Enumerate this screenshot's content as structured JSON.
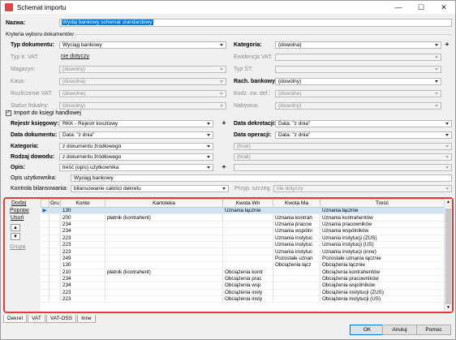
{
  "window": {
    "title": "Schemat importu",
    "minimize": "—",
    "maximize": "☐",
    "close": "✕"
  },
  "name_label": "Nazwa:",
  "name_value": "Wydaj bankowy schemat standardowy",
  "criteria_title": "Kryteria wyboru dokumentów",
  "left": [
    {
      "label": "Typ dokumentu:",
      "value": "Wyciąg bankowy",
      "bold": true,
      "disabled": false,
      "dd": true
    },
    {
      "label": "Typ tr. VAT:",
      "value": "nie dotyczy",
      "bold": false,
      "disabled": true,
      "link": true
    },
    {
      "label": "Magazyn:",
      "value": "(dowolny)",
      "bold": false,
      "disabled": true,
      "dd": true
    },
    {
      "label": "Kasa:",
      "value": "(dowolna)",
      "bold": false,
      "disabled": true,
      "dd": true
    },
    {
      "label": "Rozliczenie VAT:",
      "value": "(dowolne)",
      "bold": false,
      "disabled": true,
      "dd": true
    },
    {
      "label": "Status fiskalny:",
      "value": "(dowolny)",
      "bold": false,
      "disabled": true,
      "dd": true
    }
  ],
  "right": [
    {
      "label": "Kategoria:",
      "value": "(dowolna)",
      "bold": true,
      "disabled": false,
      "dd": true,
      "plus": true
    },
    {
      "label": "Ewidencja VAT:",
      "value": "",
      "bold": false,
      "disabled": true,
      "dd": true
    },
    {
      "label": "Typ ŚT:",
      "value": "",
      "bold": false,
      "disabled": true,
      "dd": true
    },
    {
      "label": "Rach. bankowy:",
      "value": "(dowolny)",
      "bold": true,
      "disabled": false,
      "dd": true
    },
    {
      "label": "Kodz. zw. def.:",
      "value": "(dowolne)",
      "bold": false,
      "disabled": true,
      "dd": true
    },
    {
      "label": "Nabywca:",
      "value": "(dowolny)",
      "bold": false,
      "disabled": true,
      "dd": true
    }
  ],
  "import_label": "Import do księgi handlowej",
  "import_checked": "✓",
  "book_left": [
    {
      "label": "Rejestr księgowy:",
      "value": "RKK - Rejestr kosztowy",
      "dd": true,
      "plus": true
    },
    {
      "label": "Data dokumentu:",
      "value": "Data: \"z dnia\"",
      "dd": true
    },
    {
      "label": "Kategoria:",
      "value": "z dokumentu źródłowego",
      "dd": true
    },
    {
      "label": "Rodzaj dowodu:",
      "value": "z dokumentu źródłowego",
      "dd": true
    },
    {
      "label": "Opis:",
      "value": "treść (opis) użytkownika",
      "dd": true,
      "plus": true
    }
  ],
  "book_right": [
    {
      "label": "Data dekretacji:",
      "value": "Data: \"z dnia\"",
      "dd": true,
      "disabled": false
    },
    {
      "label": "Data operacji:",
      "value": "Data: \"z dnia\"",
      "dd": true,
      "disabled": false
    },
    {
      "label": "",
      "value": "(brak)",
      "dd": true,
      "disabled": true
    },
    {
      "label": "",
      "value": "(brak)",
      "dd": true,
      "disabled": true
    },
    {
      "label": "",
      "value": "",
      "dd": true,
      "disabled": true
    }
  ],
  "user_desc_label": "Opis użytkownika:",
  "user_desc_value": "Wyciąg bankowy",
  "control_label": "Kontrola bilansowania:",
  "control_value": "bilansowanie całości dekretu",
  "przyp_label": "Przyp. szczeg. PIT:",
  "przyp_value": "nie dotyczy",
  "side_links": {
    "add": "Dodaj",
    "edit": "Popraw",
    "delete": "Usuń",
    "groups": "Grupa"
  },
  "columns": [
    "",
    "Gru",
    "Konto",
    "Kartoteka",
    "Kwota Wn",
    "Kwota Ma",
    "Treść"
  ],
  "rows": [
    {
      "gru": "",
      "konto": "130",
      "kart": "",
      "wn": "Uznania łącznie",
      "ma": "",
      "tresc": "Uznania łącznie",
      "sel": true
    },
    {
      "gru": "",
      "konto": "200",
      "kart": "płatnik (kontrahent)",
      "wn": "",
      "ma": "Uznania kontrah",
      "tresc": "Uznania kontrahentów"
    },
    {
      "gru": "",
      "konto": "234",
      "kart": "",
      "wn": "",
      "ma": "Uznania pracow",
      "tresc": "Uznania pracowników"
    },
    {
      "gru": "",
      "konto": "234",
      "kart": "",
      "wn": "",
      "ma": "Uznania wspólni",
      "tresc": "Uznania wspólników"
    },
    {
      "gru": "",
      "konto": "223",
      "kart": "",
      "wn": "",
      "ma": "Uznania instytuc",
      "tresc": "Uznania instytucji (ZUS)"
    },
    {
      "gru": "",
      "konto": "223",
      "kart": "",
      "wn": "",
      "ma": "Uznania instytuc",
      "tresc": "Uznania instytucji (US)"
    },
    {
      "gru": "",
      "konto": "223",
      "kart": "",
      "wn": "",
      "ma": "Uznania instytuc",
      "tresc": "Uznania instytucji (inne)"
    },
    {
      "gru": "",
      "konto": "249",
      "kart": "",
      "wn": "",
      "ma": "Pozostałe uznan",
      "tresc": "Pozostałe uznania łącznie"
    },
    {
      "gru": "",
      "konto": "130",
      "kart": "",
      "wn": "",
      "ma": "Obciążenia łącz",
      "tresc": "Obciążenia łącznie"
    },
    {
      "gru": "",
      "konto": "210",
      "kart": "płatnik (kontrahent)",
      "wn": "Obciążenia kontr",
      "ma": "",
      "tresc": "Obciążenia kontrahentów"
    },
    {
      "gru": "",
      "konto": "234",
      "kart": "",
      "wn": "Obciążenia prac",
      "ma": "",
      "tresc": "Obciążenia pracowników"
    },
    {
      "gru": "",
      "konto": "234",
      "kart": "",
      "wn": "Obciążenia wsp",
      "ma": "",
      "tresc": "Obciążenia wspólników"
    },
    {
      "gru": "",
      "konto": "223",
      "kart": "",
      "wn": "Obciążenia insty",
      "ma": "",
      "tresc": "Obciążenia instytucji (ZUS)"
    },
    {
      "gru": "",
      "konto": "223",
      "kart": "",
      "wn": "Obciążenia insty",
      "ma": "",
      "tresc": "Obciążenia instytucji (US)"
    }
  ],
  "tabs": [
    "Dekret",
    "VAT",
    "VAT-OSS",
    "Inne"
  ],
  "buttons": {
    "ok": "OK",
    "cancel": "Anuluj",
    "help": "Pomoc"
  },
  "colors": {
    "accent": "#0078d7",
    "highlight": "#e53a3a",
    "selected_row": "#cfe3f7"
  }
}
